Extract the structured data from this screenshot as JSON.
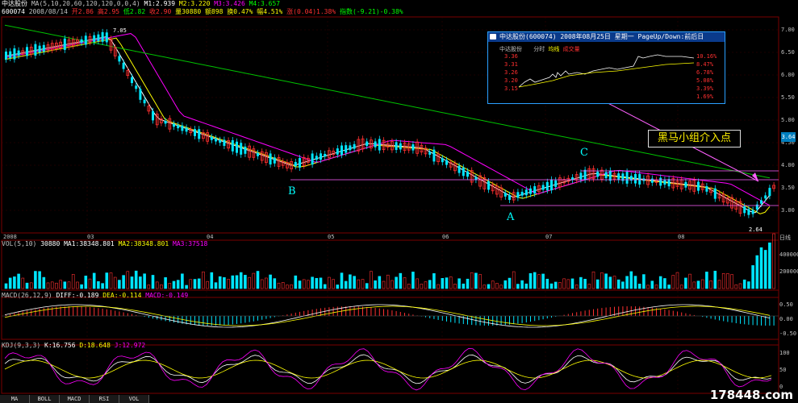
{
  "header": {
    "stock_name": "中达股份",
    "ma_params": "MA(5,10,20,60,120,120,0,0,4)",
    "ma1": "M1:2.939",
    "ma2": "M2:3.220",
    "ma3": "M3:3.426",
    "ma4": "M4:3.657",
    "row2_code": "600074",
    "row2_date": "2008/08/14",
    "row2_open": "开2.86",
    "row2_high": "高2.95",
    "row2_low": "低2.82",
    "row2_close": "收2.90",
    "row2_vol": "量30880",
    "row2_amount": "额898",
    "row2_turnover": "换0.47%",
    "row2_amp": "幅4.51%",
    "row2_chg": "涨(0.04)1.38%",
    "row2_index": "指数(-9.21)-0.38%"
  },
  "price_axis": [
    "7.00",
    "6.50",
    "6.00",
    "5.50",
    "5.00",
    "4.50",
    "4.00",
    "3.50",
    "3.00"
  ],
  "current_price": "3.64",
  "price_marks": {
    "high": "7.05",
    "low": "2.64"
  },
  "time_axis": [
    "2008",
    "03",
    "04",
    "05",
    "06",
    "07",
    "08",
    "日线"
  ],
  "points": {
    "A": "A",
    "B": "B",
    "C": "C"
  },
  "callout": "黑马小组介入点",
  "popup": {
    "title": "中达股份(600074) 2008年08月25日 星期一 PageUp/Down:前后日 ",
    "sub_name": "中达股份",
    "sub_tab_time": "分时",
    "sub_tab_avg": "均线",
    "sub_tab_vol": "成交量",
    "left_axis": [
      "3.36",
      "3.31",
      "3.26",
      "3.20",
      "3.15"
    ],
    "right_axis": [
      "10.16%",
      "8.47%",
      "6.78%",
      "5.08%",
      "3.39%",
      "1.69%"
    ]
  },
  "vol": {
    "label": "VOL(5,10)",
    "value": "30880",
    "ma1": "MA1:38348.801",
    "ma2": "MA2:38348.801",
    "ma3": "MA3:37518",
    "axis": [
      "400000",
      "200000"
    ]
  },
  "macd": {
    "label": "MACD(26,12,9)",
    "diff": "DIFF:-0.189",
    "dea": "DEA:-0.114",
    "macd": "MACD:-0.149",
    "axis": [
      "0.50",
      "0.00",
      "-0.50"
    ]
  },
  "kdj": {
    "label": "KDJ(9,3,3)",
    "k": "K:16.756",
    "d": "D:18.648",
    "j": "J:12.972",
    "axis": [
      "100",
      "50",
      "0"
    ]
  },
  "tabs": [
    "MA",
    "BOLL",
    "MACD",
    "RSI",
    "VOL"
  ],
  "watermark": "178448.com",
  "colors": {
    "up": "#ff3030",
    "down": "#00e5ff",
    "ma5": "#ffffff",
    "ma10": "#ffff00",
    "ma20": "#ff00ff",
    "ma60": "#00c000",
    "grid": "#6a0000"
  }
}
